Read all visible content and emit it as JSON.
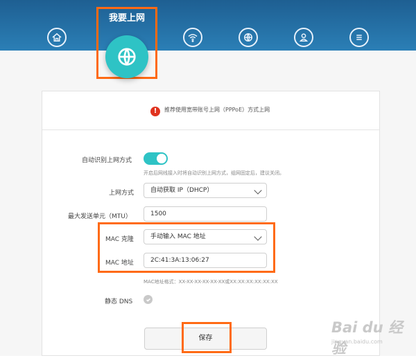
{
  "header": {
    "active_tab_label": "我要上网",
    "icons": [
      "home-icon",
      "globe-icon",
      "wifi-icon",
      "settings-globe-icon",
      "user-icon",
      "menu-icon"
    ]
  },
  "notice": {
    "text": "推荐使用宽带账号上网（PPPoE）方式上网"
  },
  "form": {
    "auto_detect_label": "自动识别上网方式",
    "auto_detect_enabled": true,
    "auto_detect_hint": "开启后网线接入时将自动识别上网方式，组网固定后，建议关闭。",
    "method_label": "上网方式",
    "method_value": "自动获取 IP（DHCP）",
    "mtu_label": "最大发送单元（MTU）",
    "mtu_value": "1500",
    "mac_clone_label": "MAC 克隆",
    "mac_clone_value": "手动输入 MAC 地址",
    "mac_address_label": "MAC 地址",
    "mac_address_value": "2C:41:3A:13:06:27",
    "mac_format_hint": "MAC地址格式：XX-XX-XX-XX-XX-XX或XX:XX:XX:XX:XX:XX",
    "static_dns_label": "静态 DNS",
    "static_dns_enabled": false,
    "save_label": "保存"
  },
  "watermark": {
    "logo": "Bai du 经验",
    "sub": "jingyan.baidu.com"
  },
  "colors": {
    "header": "#2b7fb6",
    "accent": "#2ec3c5",
    "highlight": "#ff6a14",
    "warning": "#e0331f"
  }
}
